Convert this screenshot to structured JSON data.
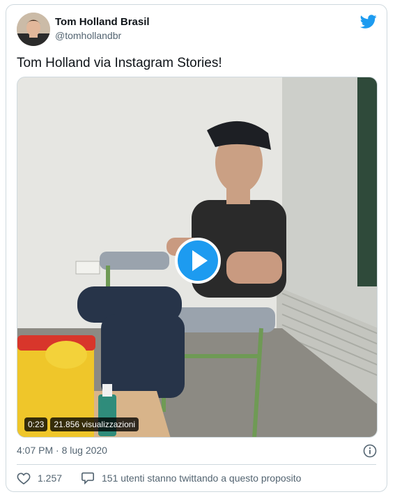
{
  "tweet": {
    "author_name": "Tom Holland Brasil",
    "author_handle": "@tomhollandbr",
    "text": "Tom Holland via Instagram Stories!",
    "timestamp": "4:07 PM · 8 lug 2020",
    "likes": "1.257",
    "replies_text": "151 utenti stanno twittando a questo proposito"
  },
  "video": {
    "duration": "0:23",
    "views": "21.856 visualizzazioni"
  },
  "colors": {
    "brand_blue": "#1d9bf0",
    "text_primary": "#0f1419",
    "text_secondary": "#536471",
    "border": "#cfd9de"
  },
  "icons": {
    "brand": "twitter-bird-icon",
    "play": "play-icon",
    "info": "info-icon",
    "like": "heart-icon",
    "reply": "speech-bubble-icon"
  }
}
